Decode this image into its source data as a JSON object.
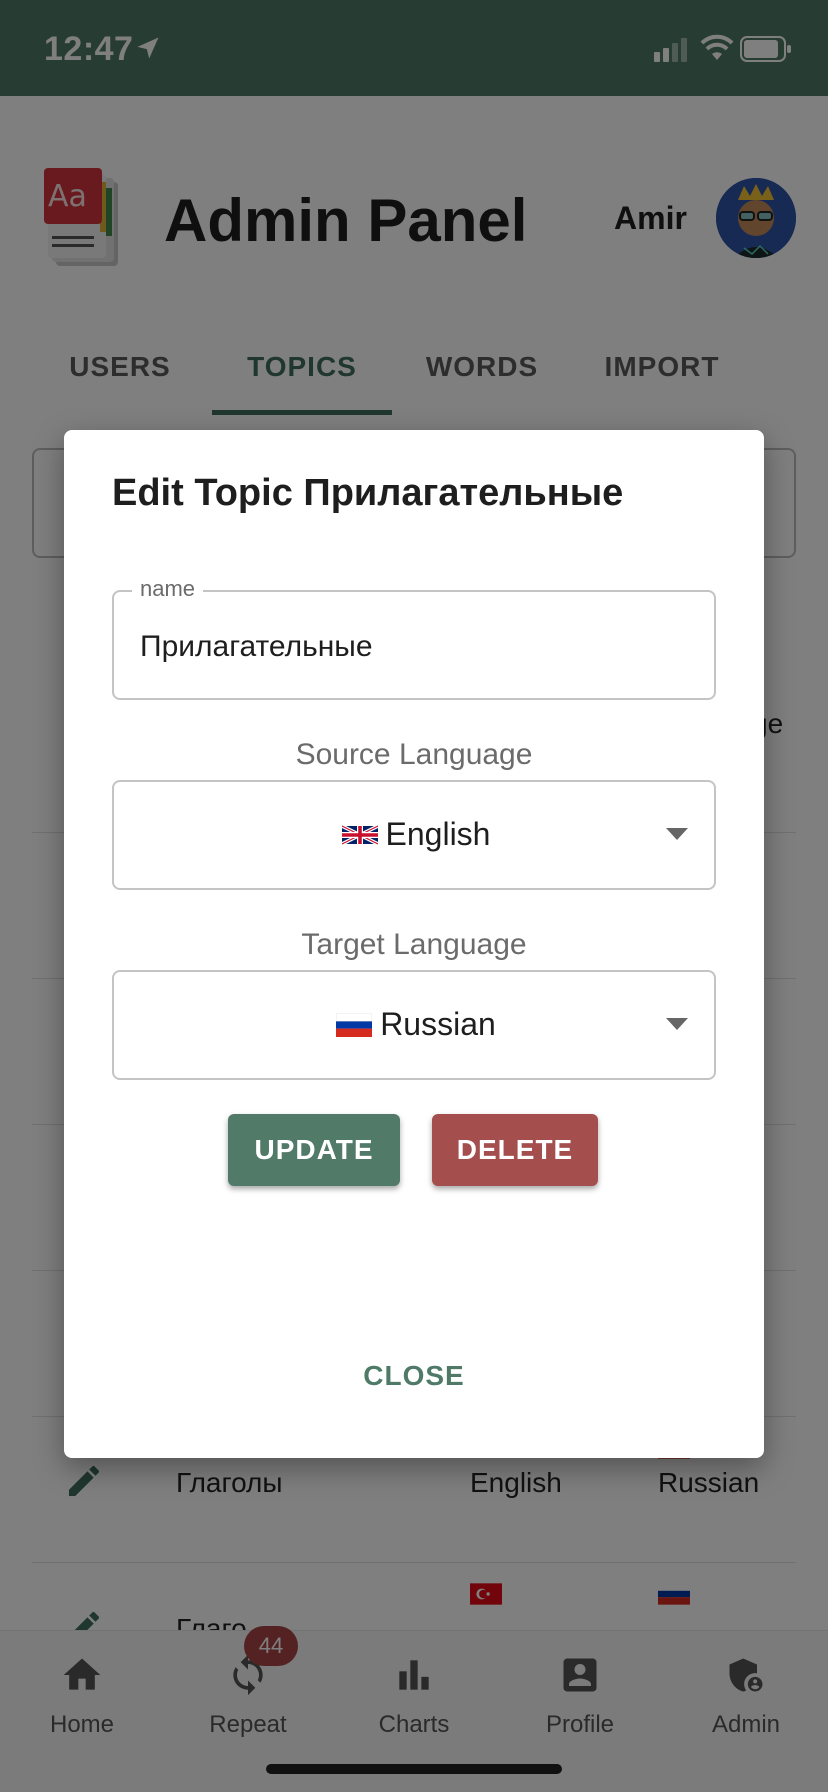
{
  "status_bar": {
    "time": "12:47"
  },
  "header": {
    "title": "Admin Panel",
    "user_name": "Amir"
  },
  "tabs": [
    {
      "label": "USERS"
    },
    {
      "label": "TOPICS"
    },
    {
      "label": "WORDS"
    },
    {
      "label": "IMPORT"
    }
  ],
  "active_tab": "TOPICS",
  "table": {
    "partial_header_text": "ge",
    "rows": [
      {
        "name": "Глаголы",
        "source": "English",
        "target": "Russian"
      },
      {
        "name": "Глаго",
        "source": "",
        "target": ""
      }
    ]
  },
  "dialog": {
    "title": "Edit Topic Прилагательные",
    "name_label": "name",
    "name_value": "Прилагательные",
    "source_caption": "Source Language",
    "source_value": "English",
    "target_caption": "Target Language",
    "target_value": "Russian",
    "update_label": "UPDATE",
    "delete_label": "DELETE",
    "close_label": "CLOSE"
  },
  "bottom_nav": {
    "items": [
      {
        "label": "Home",
        "icon": "home-icon"
      },
      {
        "label": "Repeat",
        "icon": "repeat-icon"
      },
      {
        "label": "Charts",
        "icon": "bar-chart-icon"
      },
      {
        "label": "Profile",
        "icon": "profile-icon"
      },
      {
        "label": "Admin",
        "icon": "admin-shield-icon"
      }
    ],
    "repeat_badge": "44"
  },
  "colors": {
    "primary": "#4f7a67",
    "danger": "#a44e4e",
    "badge": "#a94444"
  }
}
